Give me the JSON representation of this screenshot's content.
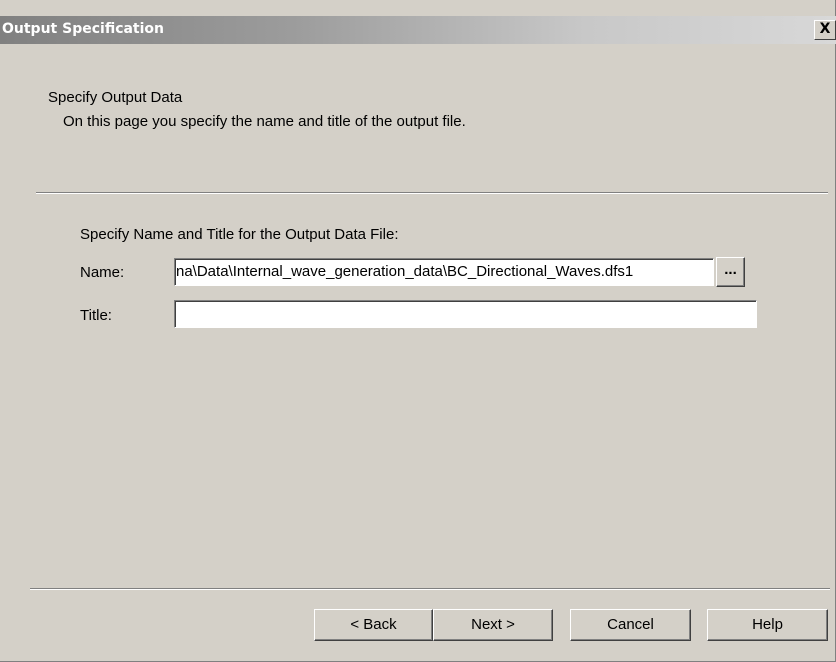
{
  "window": {
    "title": "Output Specification",
    "close_glyph": "X"
  },
  "header": {
    "title": "Specify Output Data",
    "subtitle": "On this page you specify the name and title of the output file."
  },
  "form": {
    "section_label": "Specify Name and Title for the Output Data File:",
    "name_label": "Name:",
    "name_value": "na\\Data\\Internal_wave_generation_data\\BC_Directional_Waves.dfs1",
    "browse_label": "...",
    "title_label": "Title:",
    "title_value": ""
  },
  "footer": {
    "back_label": "< Back",
    "next_label": "Next >",
    "cancel_label": "Cancel",
    "help_label": "Help"
  }
}
